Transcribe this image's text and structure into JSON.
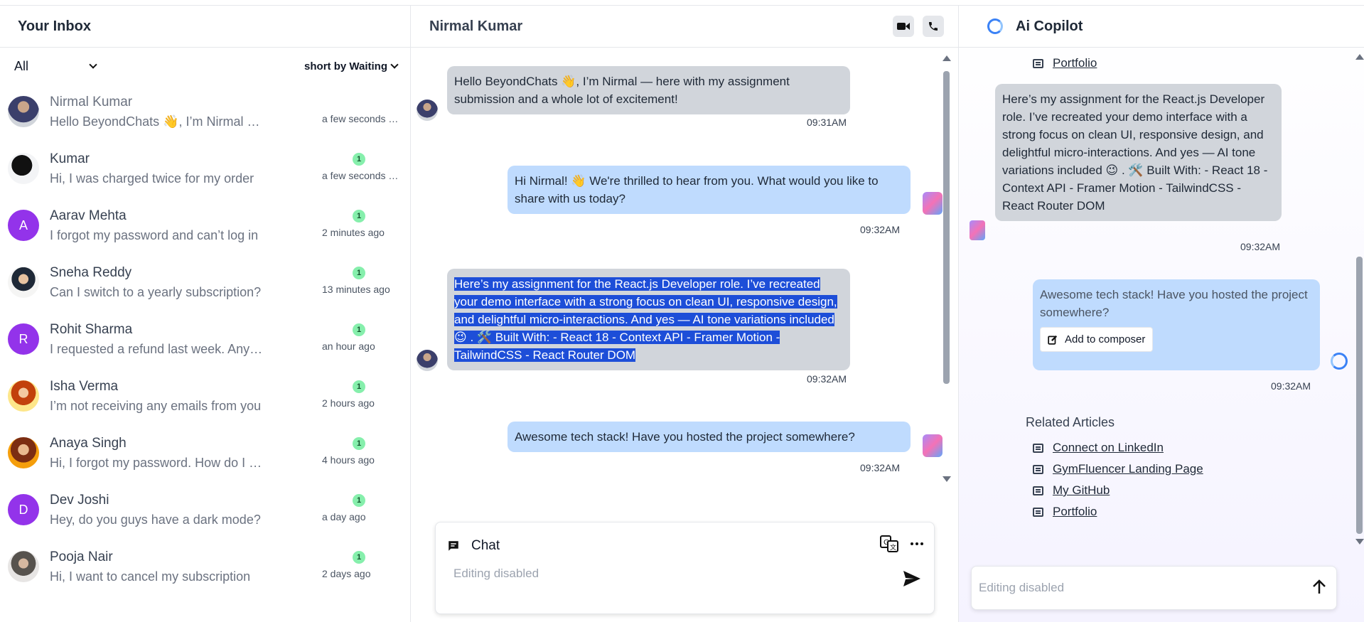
{
  "inbox": {
    "title": "Your Inbox",
    "filter_selected": "All",
    "sort_label": "short by Waiting",
    "conversations": [
      {
        "name": "Nirmal Kumar",
        "preview": "Hello BeyondChats 👋, I’m Nirmal — here with my assignment",
        "time": "a few seconds ago",
        "badge": ""
      },
      {
        "name": "Kumar",
        "preview": "Hi, I was charged twice for my order",
        "time": "a few seconds ago",
        "badge": "1"
      },
      {
        "name": "Aarav Mehta",
        "preview": "I forgot my password and can’t log in",
        "time": "2 minutes ago",
        "badge": "1",
        "initial": "A"
      },
      {
        "name": "Sneha Reddy",
        "preview": "Can I switch to a yearly subscription?",
        "time": "13 minutes ago",
        "badge": "1"
      },
      {
        "name": "Rohit Sharma",
        "preview": "I requested a refund last week. Any update?",
        "time": "an hour ago",
        "badge": "1",
        "initial": "R"
      },
      {
        "name": "Isha Verma",
        "preview": "I’m not receiving any emails from you",
        "time": "2 hours ago",
        "badge": "1"
      },
      {
        "name": "Anaya Singh",
        "preview": "Hi, I forgot my password. How do I reset it?",
        "time": "4 hours ago",
        "badge": "1"
      },
      {
        "name": "Dev Joshi",
        "preview": "Hey, do you guys have a dark mode?",
        "time": "a day ago",
        "badge": "1",
        "initial": "D"
      },
      {
        "name": "Pooja Nair",
        "preview": "Hi, I want to cancel my subscription",
        "time": "2 days ago",
        "badge": "1"
      }
    ]
  },
  "chat": {
    "title": "Nirmal Kumar",
    "messages": [
      {
        "from": "user",
        "text": "Hello BeyondChats 👋, I’m Nirmal — here with my assignment submission and a whole lot of excitement!",
        "time": "09:31AM"
      },
      {
        "from": "agent",
        "text": "Hi Nirmal! 👋 We're thrilled to hear from you. What would you like to share with us today?",
        "time": "09:32AM"
      },
      {
        "from": "user",
        "text": "Here’s my assignment for the React.js Developer role. I’ve recreated your demo interface with a strong focus on clean UI, responsive design, and delightful micro-interactions. And yes — AI tone variations included 😉 . 🛠️ Built With: - React 18 - Context API - Framer Motion - TailwindCSS - React Router DOM",
        "time": "09:32AM"
      },
      {
        "from": "agent",
        "text": "Awesome tech stack! Have you hosted the project somewhere?",
        "time": "09:32AM"
      }
    ],
    "composer": {
      "mode_label": "Chat",
      "placeholder": "Editing disabled"
    }
  },
  "copilot": {
    "title": "Ai Copilot",
    "top_link": "Portfolio",
    "user_message": "Here’s my assignment for the React.js Developer role. I’ve recreated your demo interface with a strong focus on clean UI, responsive design, and delightful micro-interactions. And yes — AI tone variations included 😉 . 🛠️ Built With: - React 18 - Context API - Framer Motion - TailwindCSS - React Router DOM",
    "user_time": "09:32AM",
    "ai_message": "Awesome tech stack! Have you hosted the project somewhere?",
    "add_to_composer": "Add to composer",
    "ai_time": "09:32AM",
    "related_title": "Related Articles",
    "related": [
      "Connect on LinkedIn",
      "GymFluencer Landing Page",
      "My GitHub",
      "Portfolio"
    ],
    "input_placeholder": "Editing disabled"
  }
}
